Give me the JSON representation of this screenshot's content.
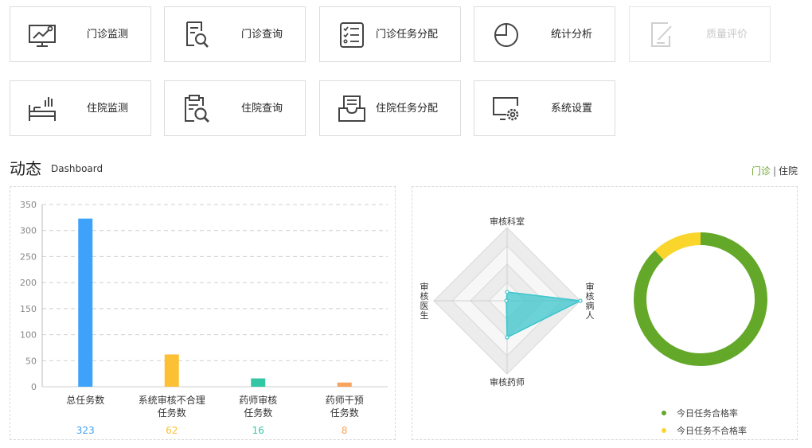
{
  "tiles": [
    {
      "label": "门诊监测",
      "icon": "monitor-chart-icon",
      "disabled": false
    },
    {
      "label": "门诊查询",
      "icon": "document-search-icon",
      "disabled": false
    },
    {
      "label": "门诊任务分配",
      "icon": "checklist-icon",
      "disabled": false
    },
    {
      "label": "统计分析",
      "icon": "pie-chart-icon",
      "disabled": false
    },
    {
      "label": "质量评价",
      "icon": "edit-document-icon",
      "disabled": true
    },
    {
      "label": "住院监测",
      "icon": "hospital-bed-icon",
      "disabled": false
    },
    {
      "label": "住院查询",
      "icon": "clipboard-search-icon",
      "disabled": false
    },
    {
      "label": "住院任务分配",
      "icon": "inbox-tray-icon",
      "disabled": false
    },
    {
      "label": "系统设置",
      "icon": "settings-monitor-icon",
      "disabled": false
    }
  ],
  "section": {
    "title": "动态",
    "subtitle": "Dashboard",
    "tab_outpatient": "门诊",
    "tab_separator": "|",
    "tab_inpatient": "住院"
  },
  "chart_data": [
    {
      "type": "bar",
      "categories": [
        "总任务数",
        "系统审核不合理任务数",
        "药师审核任务数",
        "药师干预任务数"
      ],
      "category_lines": [
        [
          "总任务数"
        ],
        [
          "系统审核不合理",
          "任务数"
        ],
        [
          "药师审核",
          "任务数"
        ],
        [
          "药师干预",
          "任务数"
        ]
      ],
      "values": [
        323,
        62,
        16,
        8
      ],
      "colors": [
        "#3ea2fb",
        "#fcc034",
        "#33c6a5",
        "#f7a45c"
      ],
      "ylim": [
        0,
        350
      ],
      "yticks": [
        0,
        50,
        100,
        150,
        200,
        250,
        300,
        350
      ],
      "grid": true
    },
    {
      "type": "radar",
      "indicators": [
        "审核科室",
        "审核病人",
        "审核药师",
        "审核医生"
      ],
      "values": [
        0.12,
        1.0,
        0.5,
        0.01
      ],
      "color": "#3cc6cc"
    },
    {
      "type": "pie",
      "donut": true,
      "labels": [
        "今日任务合格率",
        "今日任务不合格率"
      ],
      "values": [
        88,
        12
      ],
      "colors": [
        "#64a829",
        "#fad52b"
      ],
      "legend": "bottom"
    }
  ]
}
